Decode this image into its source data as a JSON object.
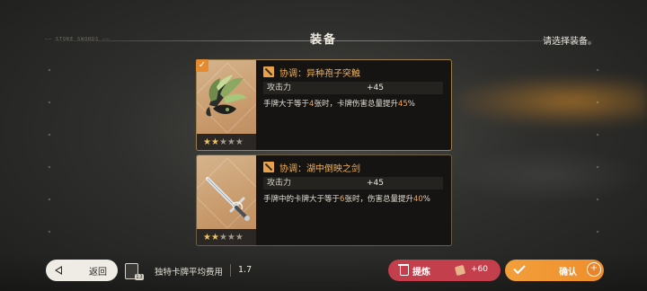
{
  "header": {
    "title": "装备",
    "hint": "请选择装备。",
    "tiny_label": "—— STORE SWORDS ——"
  },
  "cards": [
    {
      "selected": true,
      "name": "协调：异种孢子突触",
      "stat_label": "攻击力",
      "stat_value": "+45",
      "desc_a": "手牌大于等于",
      "desc_n": "4",
      "desc_b": "张时，卡牌伤害总量提升",
      "desc_p": "45",
      "desc_c": "%",
      "stars_on": "★★",
      "stars_off": "★★★",
      "rarity_level": 2,
      "rarity_max": 5,
      "art_icon": "spore-claw-icon"
    },
    {
      "selected": false,
      "name": "协调：湖中倒映之剑",
      "stat_label": "攻击力",
      "stat_value": "+45",
      "desc_a": "手牌中的卡牌大于等于",
      "desc_n": "6",
      "desc_b": "张时，伤害总量提升",
      "desc_p": "40",
      "desc_c": "%",
      "stars_on": "★★",
      "stars_off": "★★★",
      "rarity_level": 2,
      "rarity_max": 5,
      "art_icon": "sword-icon"
    }
  ],
  "bottom": {
    "back_label": "返回",
    "deck_count": "13",
    "avg_cost_label": "独特卡牌平均费用",
    "avg_cost_value": "1.7",
    "refine_label": "提炼",
    "refine_value": "+60",
    "confirm_label": "确认",
    "confirm_plus": "+"
  },
  "colors": {
    "accent_orange": "#ee8e2b",
    "refine_red": "#c33f4c",
    "highlight": "#f2a94a"
  }
}
